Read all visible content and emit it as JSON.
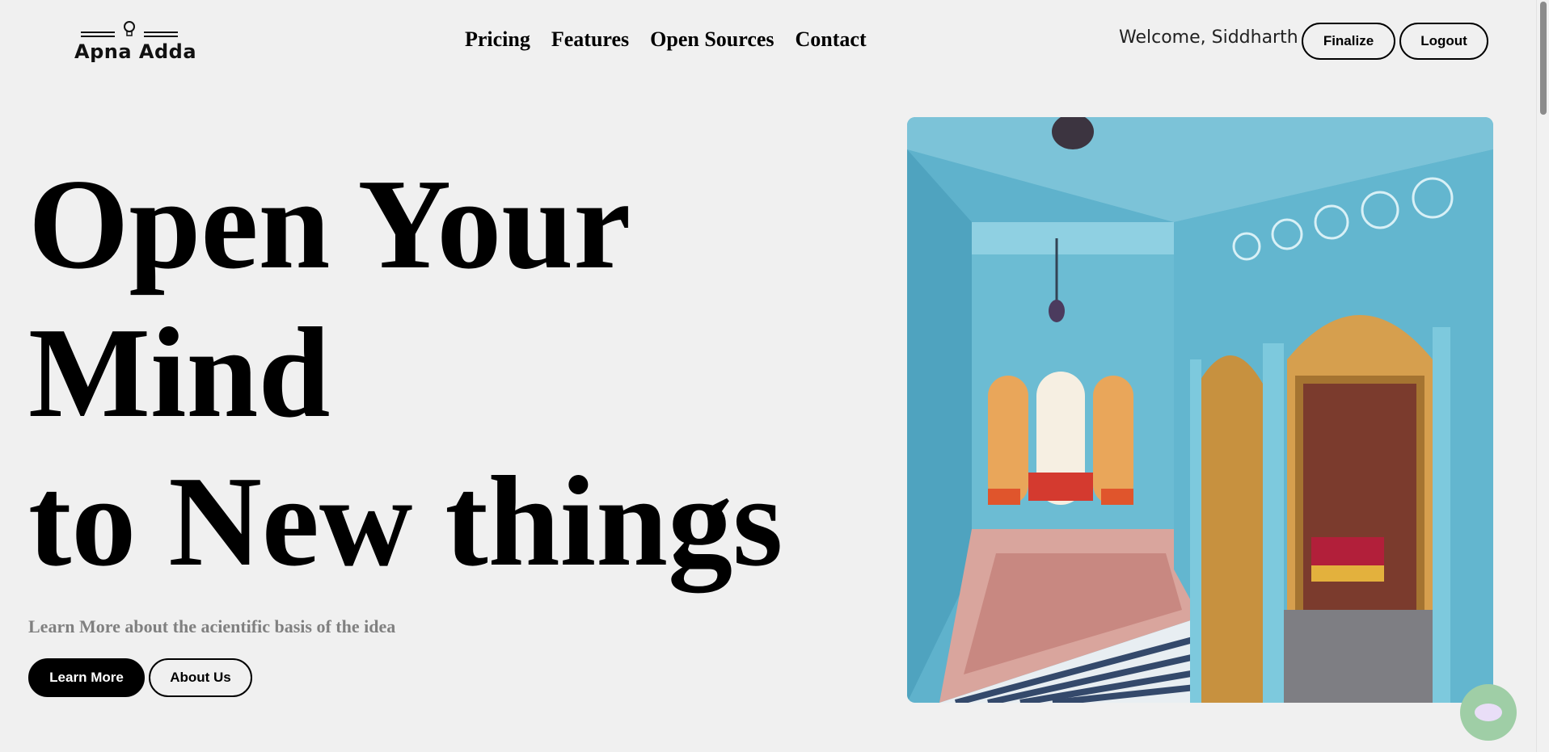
{
  "header": {
    "logo_text": "Apna Adda",
    "nav": [
      {
        "label": "Pricing"
      },
      {
        "label": "Features"
      },
      {
        "label": "Open Sources"
      },
      {
        "label": "Contact"
      }
    ],
    "welcome_text": "Welcome, Siddharth",
    "finalize_label": "Finalize",
    "logout_label": "Logout"
  },
  "hero": {
    "title_lines": [
      "Open Your",
      "Mind",
      "to New things"
    ],
    "subtitle": "Learn More about the acientific basis of the idea",
    "learn_more_label": "Learn More",
    "about_us_label": "About Us"
  },
  "colors": {
    "background": "#f0f0f0",
    "primary_button": "#000000",
    "chat_fab": "#9fcea6",
    "subtitle": "#808080"
  },
  "icons": {
    "logo": "lightbulb-icon",
    "chat": "chat-bubble-icon"
  }
}
